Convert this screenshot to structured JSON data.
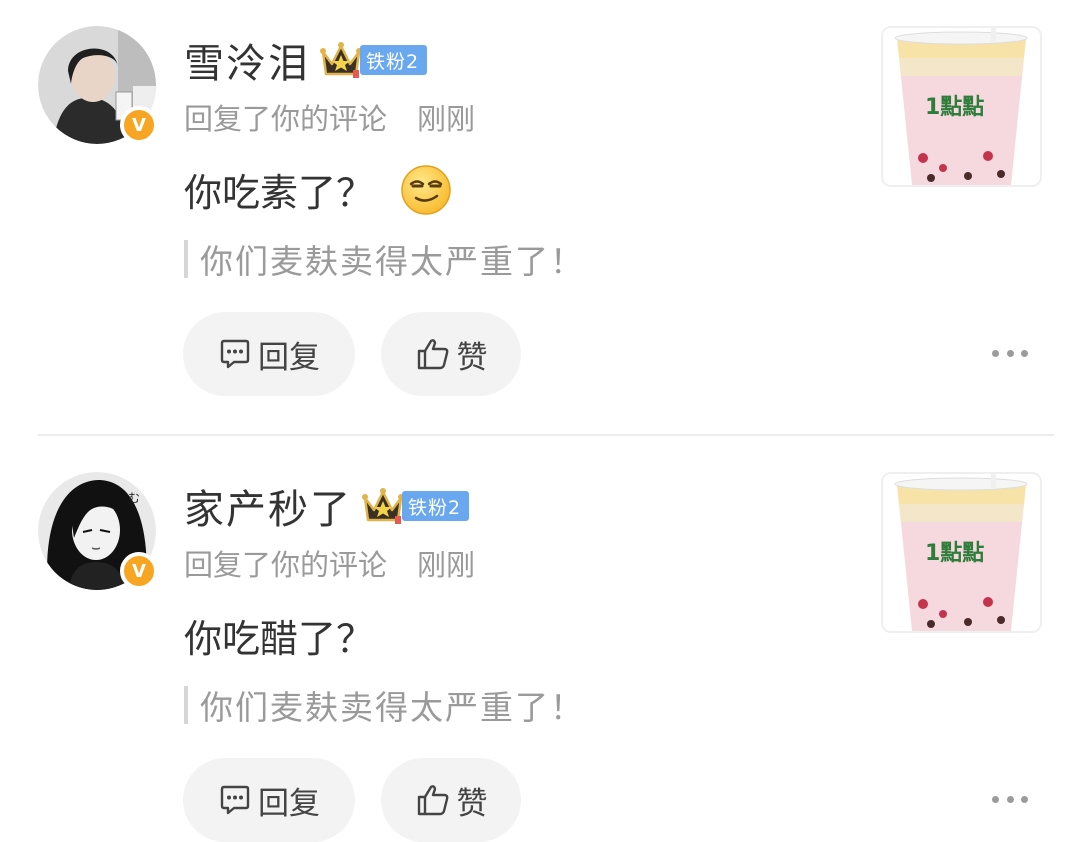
{
  "notifications": [
    {
      "username": "雪泠泪",
      "fan_badge": "铁粉2",
      "action": "回复了你的评论",
      "time": "刚刚",
      "content": "你吃素了？",
      "has_emoji": true,
      "emoji_icon": "smirk-face-icon",
      "quoted": "你们麦麸卖得太严重了！",
      "reply_label": "回复",
      "like_label": "赞",
      "thumbnail_logo": "1點點",
      "verified_badge": "V"
    },
    {
      "username": "家产秒了",
      "fan_badge": "铁粉2",
      "action": "回复了你的评论",
      "time": "刚刚",
      "content": "你吃醋了？",
      "has_emoji": false,
      "quoted": "你们麦麸卖得太严重了！",
      "reply_label": "回复",
      "like_label": "赞",
      "thumbnail_logo": "1點點",
      "verified_badge": "V"
    }
  ],
  "colors": {
    "fan_badge_bg": "#69a7ef",
    "verified_badge": "#f6a623",
    "secondary_text": "#9a9a9a",
    "button_bg": "#f3f3f3"
  }
}
